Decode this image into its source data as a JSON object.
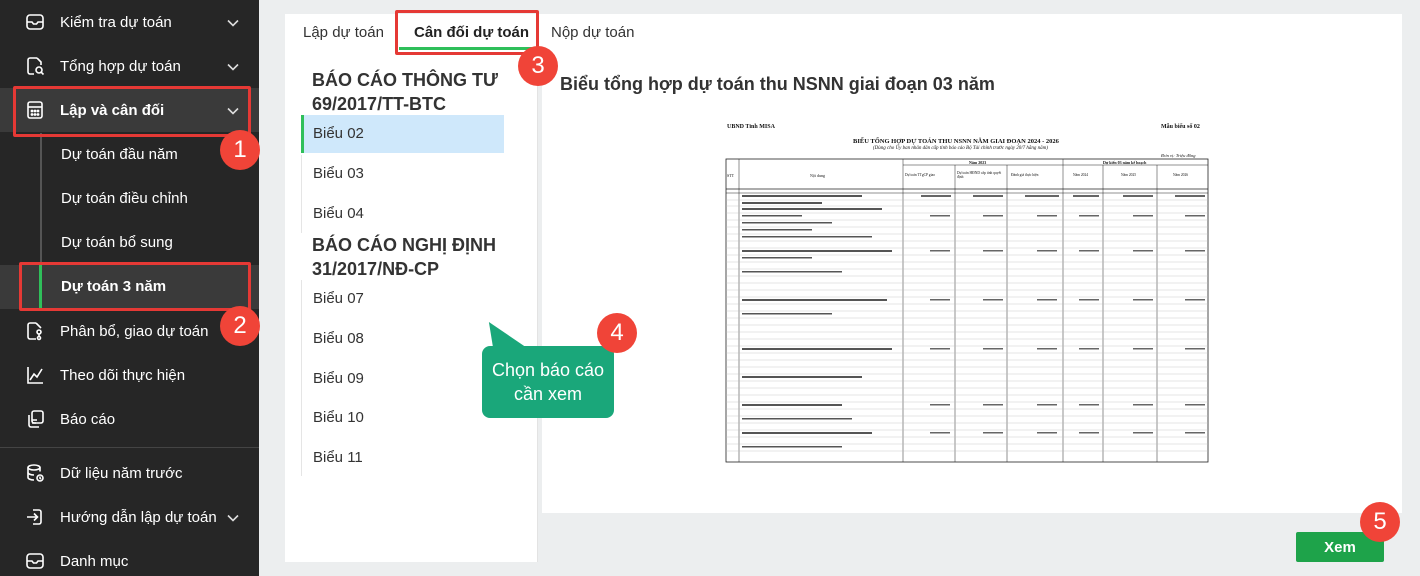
{
  "sidebar": {
    "items": [
      {
        "label": "Kiểm tra dự toán",
        "icon": "inbox-icon",
        "chevron": true
      },
      {
        "label": "Tổng hợp dự toán",
        "icon": "doc-search-icon",
        "chevron": true
      },
      {
        "label": "Lập và cân đối",
        "icon": "calculator-icon",
        "chevron": true
      },
      {
        "label": "Phân bổ, giao dự toán",
        "icon": "flow-icon",
        "chevron": false
      },
      {
        "label": "Theo dõi thực hiện",
        "icon": "line-chart-icon",
        "chevron": false
      },
      {
        "label": "Báo cáo",
        "icon": "report-icon",
        "chevron": false
      },
      {
        "label": "Dữ liệu năm trước",
        "icon": "database-icon",
        "chevron": false
      },
      {
        "label": "Hướng dẫn lập dự toán",
        "icon": "login-icon",
        "chevron": true
      },
      {
        "label": "Danh mục",
        "icon": "inbox-icon",
        "chevron": false
      }
    ],
    "sub_items": [
      {
        "label": "Dự toán đầu năm"
      },
      {
        "label": "Dự toán điều chỉnh"
      },
      {
        "label": "Dự toán bổ sung"
      },
      {
        "label": "Dự toán 3 năm"
      }
    ]
  },
  "tabs": [
    {
      "label": "Lập dự toán"
    },
    {
      "label": "Cân đối dự toán"
    },
    {
      "label": "Nộp dự toán"
    }
  ],
  "report_groups": [
    {
      "title": "BÁO CÁO THÔNG TƯ 69/2017/TT-BTC",
      "items": [
        "Biểu 02",
        "Biểu 03",
        "Biểu 04"
      ]
    },
    {
      "title": "BÁO CÁO NGHỊ ĐỊNH 31/2017/NĐ-CP",
      "items": [
        "Biểu 07",
        "Biểu 08",
        "Biểu 09",
        "Biểu 10",
        "Biểu 11"
      ]
    }
  ],
  "preview": {
    "title": "Biểu tổng hợp dự toán thu NSNN giai đoạn 03 năm",
    "doc": {
      "org": "UBND Tỉnh MISA",
      "form_no": "Mẫu biểu số 02",
      "heading": "BIỂU TỔNG HỢP DỰ TOÁN THU NSNN NĂM GIAI ĐOẠN 2024 - 2026",
      "subheading": "(Dùng cho Ủy ban nhân dân cấp tỉnh báo cáo Bộ Tài chính trước ngày 20/7 hằng năm)",
      "unit": "Đơn vị: Triệu đồng",
      "col_stt": "STT",
      "col_content": "Nội dung",
      "col_year2023": "Năm 2023",
      "col_plan": "Dự kiến 03 năm kế hoạch",
      "cols": [
        "Dự toán TTgCP giao",
        "Dự toán HĐND cấp tỉnh quyết định",
        "Đánh giá thực hiện",
        "Năm 2024",
        "Năm 2025",
        "Năm 2026"
      ]
    }
  },
  "callout": {
    "text": "Chọn báo cáo cần xem"
  },
  "badges": [
    "1",
    "2",
    "3",
    "4",
    "5"
  ],
  "buttons": {
    "view": "Xem"
  },
  "colors": {
    "sidebar_bg": "#262626",
    "accent_green": "#2fbf5a",
    "badge_red": "#f04438",
    "callout_teal": "#1aa77a",
    "selected_blue": "#cfe8fb"
  }
}
